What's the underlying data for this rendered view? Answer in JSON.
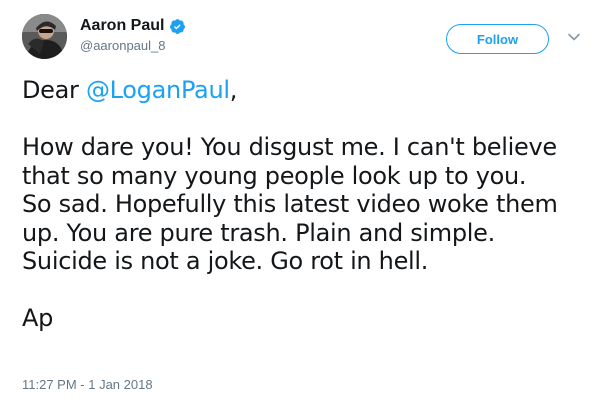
{
  "author": {
    "display_name": "Aaron Paul",
    "handle": "@aaronpaul_8",
    "verified": true,
    "avatar": "profile-photo"
  },
  "actions": {
    "follow_label": "Follow",
    "menu_icon": "chevron-down-icon"
  },
  "tweet": {
    "greeting_prefix": "Dear ",
    "mention": "@LoganPaul",
    "greeting_suffix": ",",
    "body_lines": [
      "How dare you! You disgust me. I can't believe",
      "that so many young people look up to you.",
      "So sad. Hopefully this latest video woke them",
      "up. You are pure trash. Plain and simple.",
      "Suicide is not a joke. Go rot in hell."
    ],
    "signature": "Ap",
    "timestamp": "11:27 PM - 1 Jan 2018"
  },
  "colors": {
    "accent": "#1da1f2",
    "text": "#14171a",
    "muted": "#657786"
  }
}
